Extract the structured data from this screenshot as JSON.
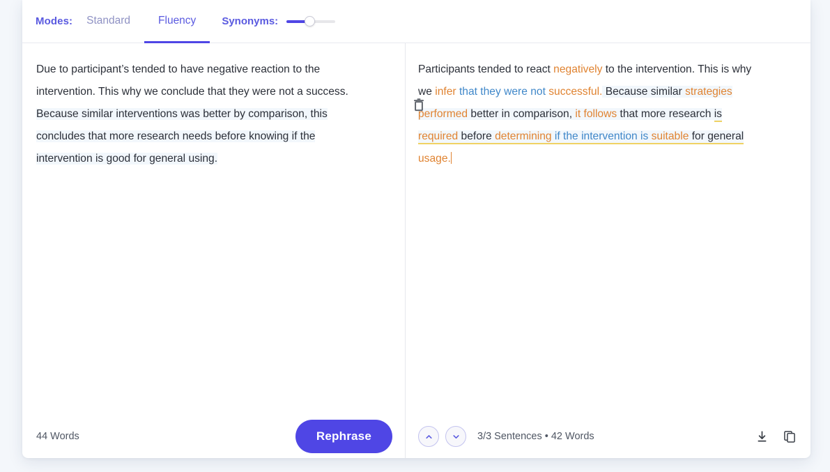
{
  "toolbar": {
    "modes_label": "Modes:",
    "tabs": [
      {
        "label": "Standard",
        "active": false
      },
      {
        "label": "Fluency",
        "active": true
      }
    ],
    "synonyms_label": "Synonyms:",
    "synonyms_value": 45
  },
  "input_panel": {
    "clear_icon": "trash-icon",
    "text": "Due to participant’s tended to have negative reaction to the intervention. This why we conclude that they were not a success. Because similar interventions was better by comparison, this concludes that more research needs before knowing if the intervention is good for general using.",
    "lines": [
      {
        "text": "Due to participant’s tended to have negative reaction to the",
        "highlight": false
      },
      {
        "text": "intervention. This why we conclude that they were not a success.",
        "highlight": false
      },
      {
        "text": "Because similar interventions was better by comparison, this",
        "highlight": true
      },
      {
        "text": "concludes that more research needs before knowing if the",
        "highlight": true
      },
      {
        "text": "intervention is good for general using.",
        "highlight": true
      }
    ],
    "word_count": "44 Words"
  },
  "output_panel": {
    "text": "Participants tended to react negatively to the intervention. This is why we infer that they were not successful. Because similar strategies performed better in comparison, it follows that more research is required before determining if the intervention is suitable for general usage.",
    "runs": [
      {
        "text": "Participants tended to react ",
        "color": "plain"
      },
      {
        "text": "negatively",
        "color": "orange"
      },
      {
        "text": " to the intervention. This is why",
        "color": "plain"
      },
      {
        "text": "we ",
        "color": "plain"
      },
      {
        "text": "infer",
        "color": "orange"
      },
      {
        "text": " that they were not",
        "color": "blue"
      },
      {
        "text": " successful.",
        "color": "orange"
      },
      {
        "text": " Because similar ",
        "color": "plain"
      },
      {
        "text": "strategies",
        "color": "orange"
      },
      {
        "text": "performed",
        "color": "orange"
      },
      {
        "text": " better in comparison, ",
        "color": "plain"
      },
      {
        "text": "it follows",
        "color": "orange"
      },
      {
        "text": " that more research ",
        "color": "plain"
      },
      {
        "text": "is",
        "color": "plain"
      },
      {
        "text": "required",
        "color": "orange"
      },
      {
        "text": " before ",
        "color": "plain"
      },
      {
        "text": "determining",
        "color": "orange"
      },
      {
        "text": " if the intervention is",
        "color": "blue"
      },
      {
        "text": " suitable",
        "color": "orange"
      },
      {
        "text": " for general",
        "color": "plain"
      },
      {
        "text": "usage.",
        "color": "orange"
      }
    ],
    "sentence_counter": "3/3 Sentences",
    "separator": "•",
    "word_count": "42 Words",
    "prev_icon": "chevron-up-icon",
    "next_icon": "chevron-down-icon",
    "download_icon": "download-icon",
    "copy_icon": "copy-icon"
  },
  "actions": {
    "rephrase_label": "Rephrase"
  },
  "colors": {
    "accent": "#4f46e5",
    "accent_text": "#5a5ae0",
    "muted_tab": "#8f92c4",
    "synonym_orange": "#e08331",
    "synonym_blue": "#3f87c9",
    "underline_gold": "#f0d264",
    "page_background": "#f4f7fb",
    "card_background": "#ffffff",
    "body_text": "#2b2f38"
  }
}
